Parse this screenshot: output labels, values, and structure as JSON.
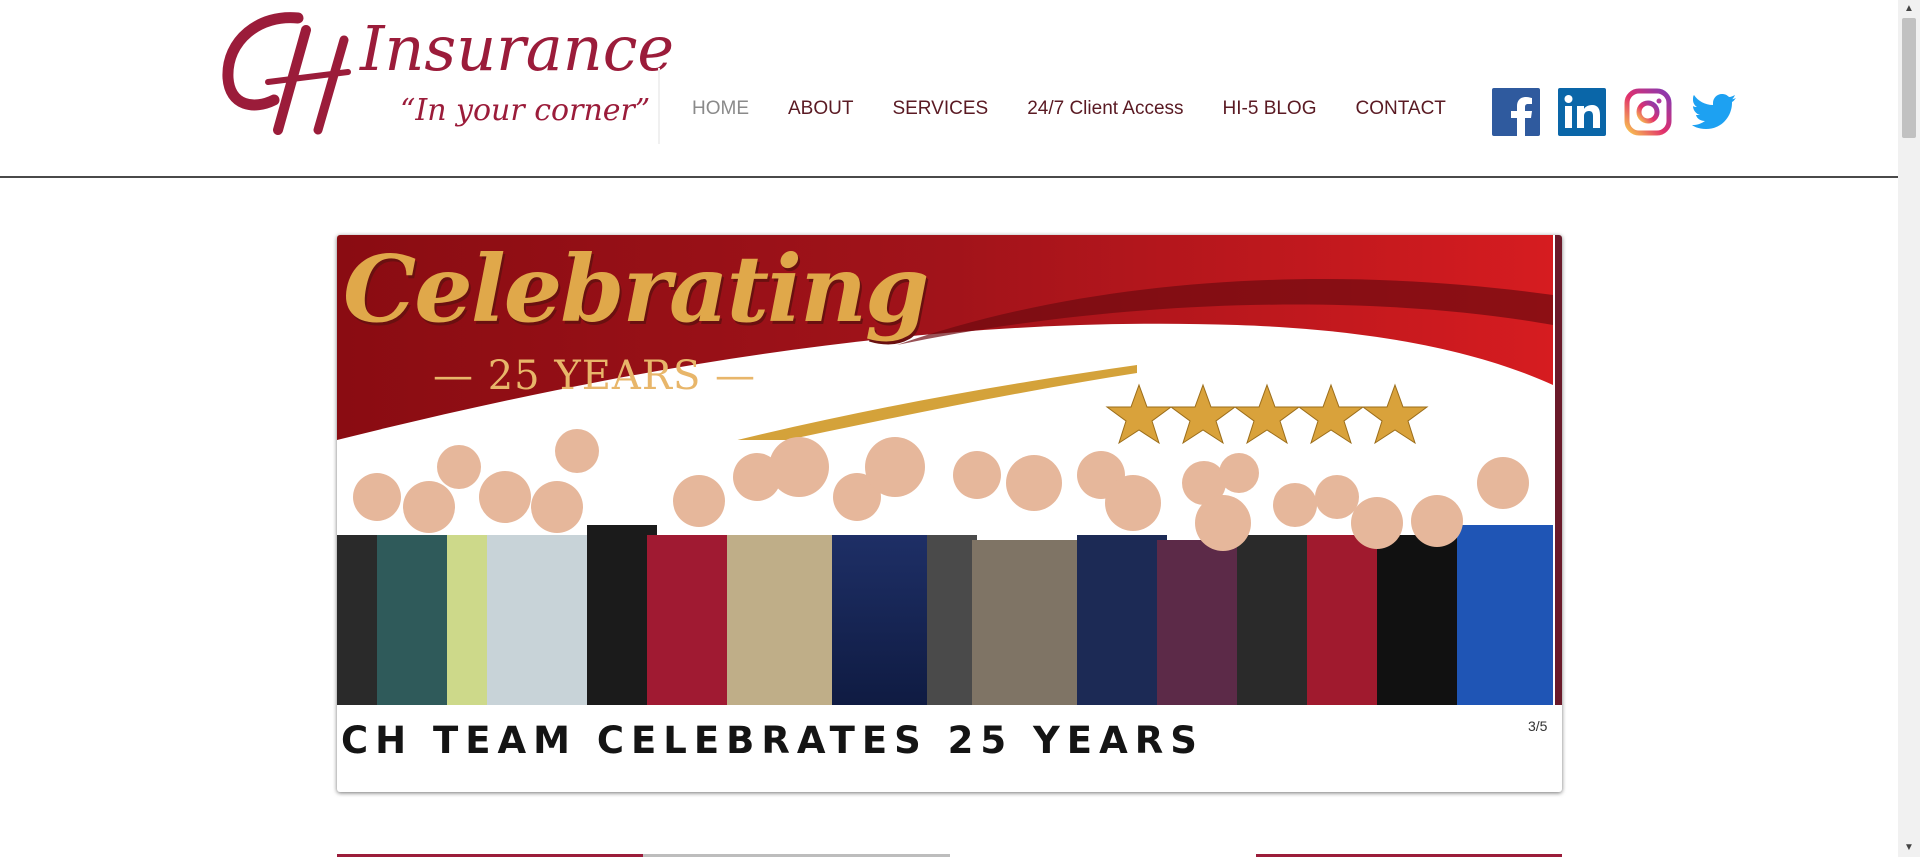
{
  "brand": {
    "monogram": "CH",
    "name": "Insurance",
    "tagline": "“In your corner”",
    "color": "#9b1c3a"
  },
  "nav": {
    "items": [
      {
        "label": "HOME",
        "active": true
      },
      {
        "label": "ABOUT",
        "active": false
      },
      {
        "label": "SERVICES",
        "active": false
      },
      {
        "label": "24/7 Client Access",
        "active": false
      },
      {
        "label": "HI-5 BLOG",
        "active": false
      },
      {
        "label": "CONTACT",
        "active": false
      }
    ]
  },
  "social": [
    {
      "name": "facebook-icon",
      "color": "#2f5a9e"
    },
    {
      "name": "linkedin-icon",
      "color": "#0a66a8"
    },
    {
      "name": "instagram-icon",
      "color": "#d6249f"
    },
    {
      "name": "twitter-icon",
      "color": "#1da1f2"
    }
  ],
  "slideshow": {
    "banner": {
      "script_title": "Celebrating",
      "subtitle": "— 25 YEARS —",
      "stars": 5
    },
    "caption": "CH TEAM CELEBRATES 25 YEARS",
    "counter": "3/5"
  }
}
